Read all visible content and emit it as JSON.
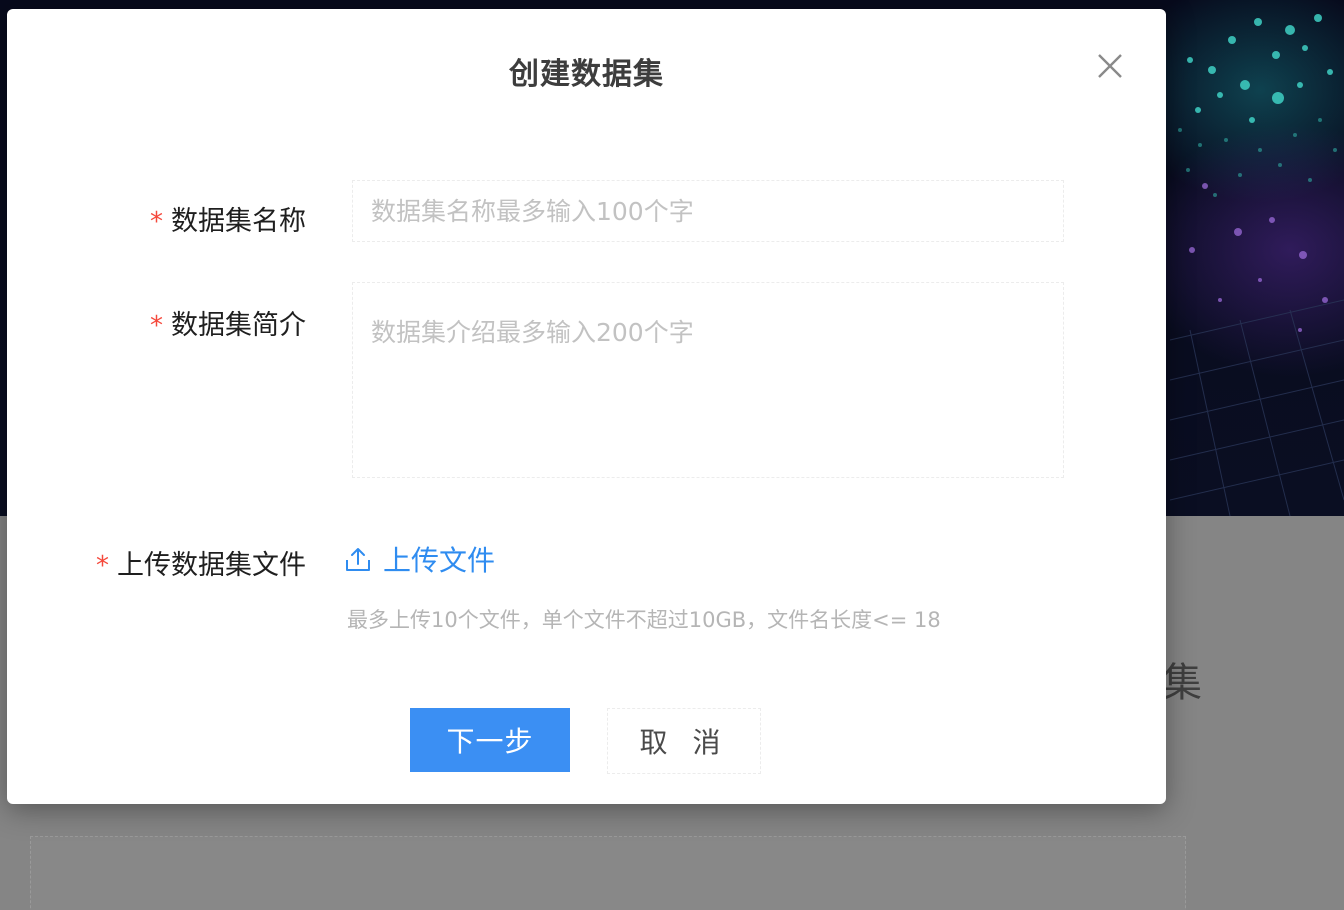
{
  "dialog": {
    "title": "创建数据集",
    "close_icon": "close-icon"
  },
  "form": {
    "name": {
      "required_mark": "*",
      "label": "数据集名称",
      "value": "",
      "placeholder": "数据集名称最多输入100个字"
    },
    "description": {
      "required_mark": "*",
      "label": "数据集简介",
      "value": "",
      "placeholder": "数据集介绍最多输入200个字"
    },
    "file": {
      "required_mark": "*",
      "label": "上传数据集文件",
      "upload_icon": "upload-icon",
      "upload_label": "上传文件",
      "hint": "最多上传10个文件，单个文件不超过10GB，文件名长度<= 18"
    }
  },
  "actions": {
    "next_label": "下一步",
    "cancel_label": "取 消"
  },
  "background": {
    "page_title_fragment": "集"
  },
  "colors": {
    "primary": "#3b8ff3",
    "link": "#2f8cf0",
    "required": "#f5483b",
    "overlay": "#858585"
  }
}
